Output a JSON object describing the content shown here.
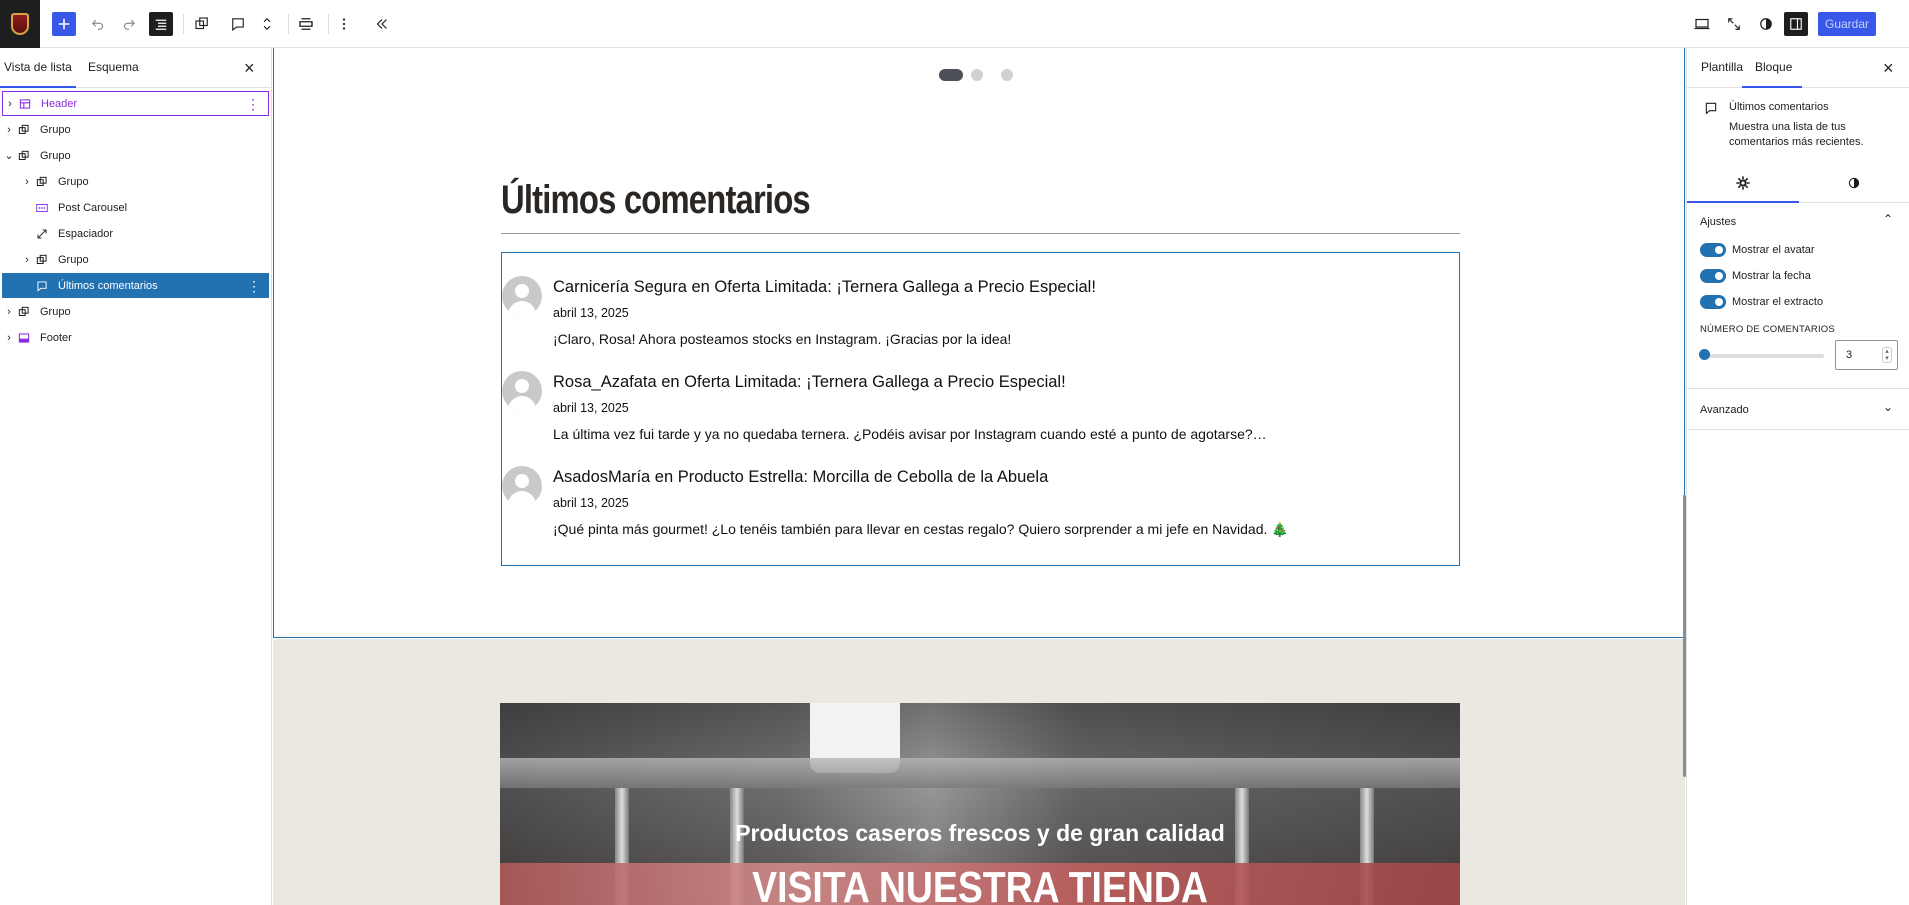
{
  "toolbar": {
    "save_label": "Guardar"
  },
  "list_view": {
    "tabs": [
      "Vista de lista",
      "Esquema"
    ],
    "items": [
      {
        "label": "Header",
        "icon": "template-part-icon",
        "expandable": true
      },
      {
        "label": "Grupo",
        "icon": "group-icon",
        "expandable": true
      },
      {
        "label": "Grupo",
        "icon": "group-icon",
        "expandable": true,
        "expanded": true
      },
      {
        "label": "Grupo",
        "icon": "group-icon",
        "expandable": true
      },
      {
        "label": "Post Carousel",
        "icon": "carousel-icon",
        "expandable": false
      },
      {
        "label": "Espaciador",
        "icon": "spacer-icon",
        "expandable": false
      },
      {
        "label": "Grupo",
        "icon": "group-icon",
        "expandable": true
      },
      {
        "label": "Últimos comentarios",
        "icon": "comment-icon",
        "expandable": false,
        "selected": true
      },
      {
        "label": "Grupo",
        "icon": "group-icon",
        "expandable": true
      },
      {
        "label": "Footer",
        "icon": "template-part-icon",
        "expandable": true
      }
    ]
  },
  "canvas": {
    "heading": "Últimos comentarios",
    "comments": [
      {
        "title": "Carnicería Segura en Oferta Limitada: ¡Ternera Gallega a Precio Especial!",
        "date": "abril 13, 2025",
        "excerpt": "¡Claro, Rosa! Ahora posteamos stocks en Instagram. ¡Gracias por la idea!"
      },
      {
        "title": "Rosa_Azafata en Oferta Limitada: ¡Ternera Gallega a Precio Especial!",
        "date": "abril 13, 2025",
        "excerpt": "La última vez fui tarde y ya no quedaba ternera. ¿Podéis avisar por Instagram cuando esté a punto de agotarse?…"
      },
      {
        "title": "AsadosMaría en Producto Estrella: Morcilla de Cebolla de la Abuela",
        "date": "abril 13, 2025",
        "excerpt": "¡Qué pinta más gourmet! ¿Lo tenéis también para llevar en cestas regalo? Quiero sorprender a mi jefe en Navidad. 🎄"
      }
    ],
    "banner": {
      "subtitle": "Productos caseros frescos y de gran calidad",
      "title": "VISITA NUESTRA TIENDA"
    }
  },
  "settings_sidebar": {
    "tabs": [
      "Plantilla",
      "Bloque"
    ],
    "active_tab": "Bloque",
    "block_title": "Últimos comentarios",
    "block_description": "Muestra una lista de tus comentarios más recientes.",
    "panel_settings": "Ajustes",
    "toggles": [
      {
        "label": "Mostrar el avatar",
        "on": true
      },
      {
        "label": "Mostrar la fecha",
        "on": true
      },
      {
        "label": "Mostrar el extracto",
        "on": true
      }
    ],
    "number_label": "NÚMERO DE COMENTARIOS",
    "number_value": "3",
    "panel_advanced": "Avanzado"
  },
  "colors": {
    "accent": "#3858e9",
    "selection": "#2271b1",
    "template_part": "#8a2be2",
    "footer_bg": "#ebe7e1"
  }
}
